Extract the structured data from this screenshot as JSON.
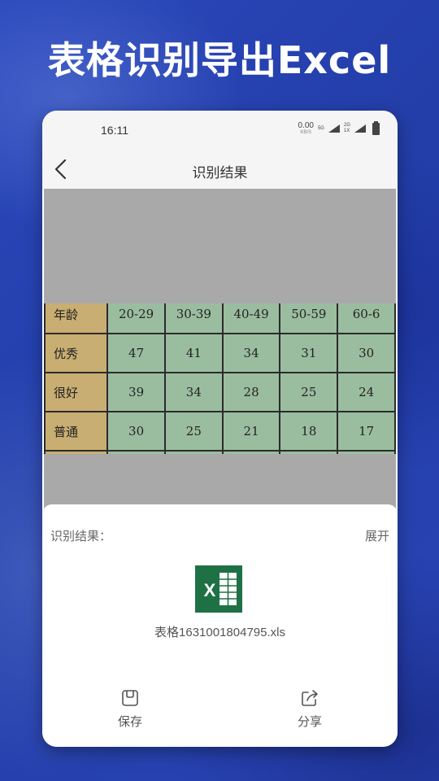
{
  "banner": {
    "headline": "表格识别导出Excel"
  },
  "status_bar": {
    "time": "16:11",
    "net_speed_value": "0.00",
    "net_speed_unit": "KB/S",
    "signal_1": "5G",
    "signal_2_top": "2G",
    "signal_2_bottom": "1X"
  },
  "nav": {
    "title": "识别结果"
  },
  "preview_table": {
    "rows": [
      {
        "label": "年龄",
        "cells": [
          "20-29",
          "30-39",
          "40-49",
          "50-59",
          "60-6"
        ]
      },
      {
        "label": "优秀",
        "cells": [
          "47",
          "41",
          "34",
          "31",
          "30"
        ]
      },
      {
        "label": "很好",
        "cells": [
          "39",
          "34",
          "28",
          "25",
          "24"
        ]
      },
      {
        "label": "普通",
        "cells": [
          "30",
          "25",
          "21",
          "18",
          "17"
        ]
      }
    ]
  },
  "result": {
    "label": "识别结果：",
    "expand": "展开",
    "file_name": "表格1631001804795.xls"
  },
  "actions": {
    "save": "保存",
    "share": "分享"
  },
  "colors": {
    "excel_green": "#1e7145",
    "background_blue": "#2a46b8"
  }
}
